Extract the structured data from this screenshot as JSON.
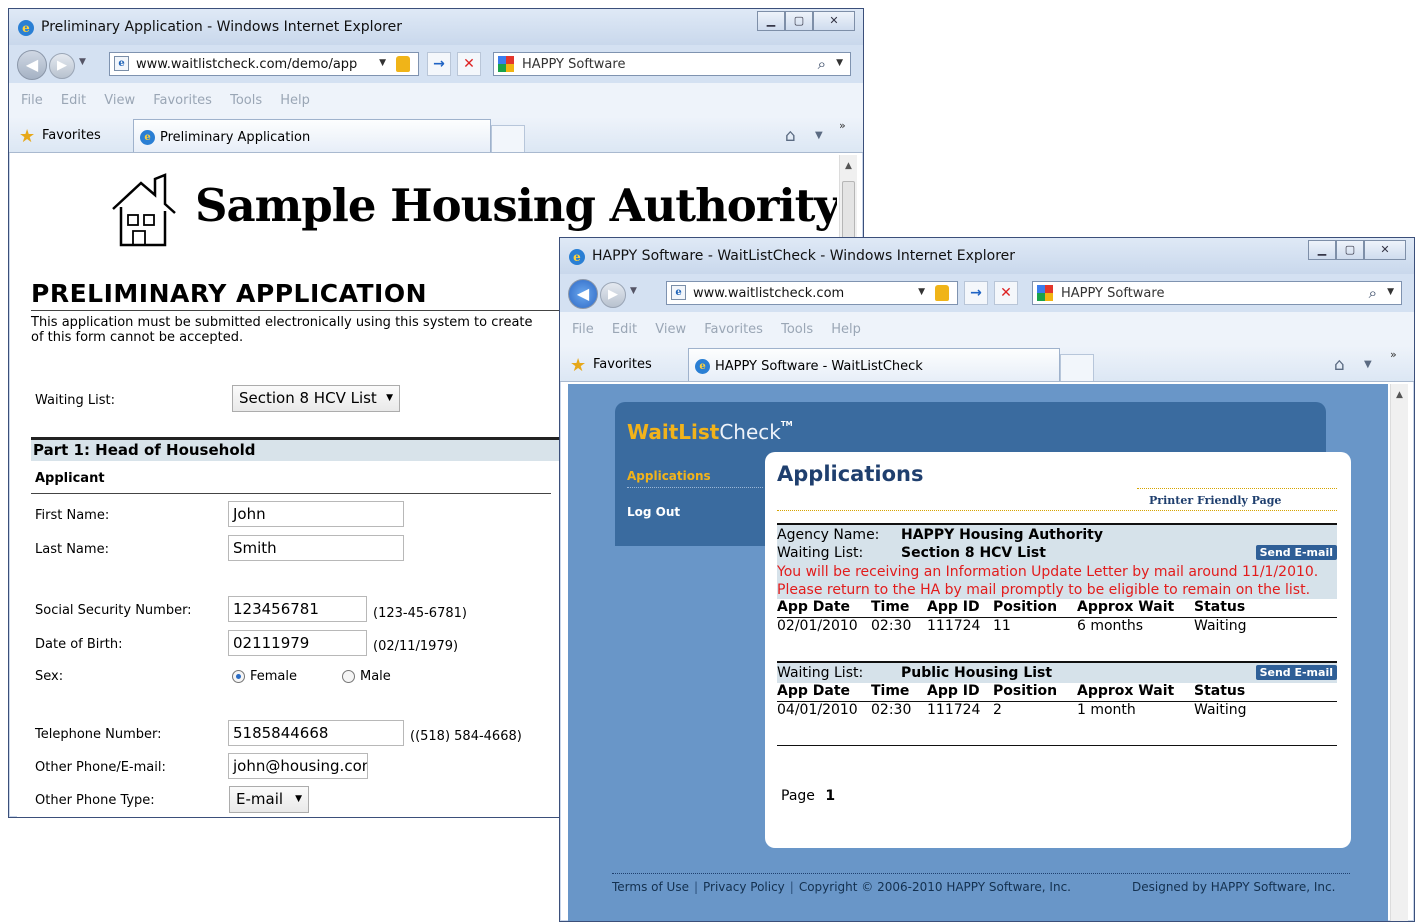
{
  "window1": {
    "title": "Preliminary Application - Windows Internet Explorer",
    "url": "www.waitlistcheck.com/demo/app",
    "search_provider": "HAPPY Software",
    "menu": [
      "File",
      "Edit",
      "View",
      "Favorites",
      "Tools",
      "Help"
    ],
    "favorites_label": "Favorites",
    "tab_title": "Preliminary Application",
    "page": {
      "agency_title": "Sample Housing Authority",
      "heading": "PRELIMINARY APPLICATION",
      "intro": "This application must be submitted electronically using this system to create",
      "intro_line2": "of this form cannot be accepted.",
      "waiting_list_label": "Waiting List:",
      "waiting_list_value": "Section 8 HCV List",
      "part1_heading": "Part 1: Head of Household",
      "applicant_heading": "Applicant",
      "first_name_label": "First Name:",
      "first_name_value": "John",
      "last_name_label": "Last Name:",
      "last_name_value": "Smith",
      "ssn_label": "Social Security Number:",
      "ssn_value": "123456781",
      "ssn_hint": "(123-45-6781)",
      "dob_label": "Date of Birth:",
      "dob_value": "02111979",
      "dob_hint": "(02/11/1979)",
      "sex_label": "Sex:",
      "sex_female": "Female",
      "sex_male": "Male",
      "sex_selected": "Female",
      "phone_label": "Telephone Number:",
      "phone_value": "5185844668",
      "phone_hint": "((518) 584-4668)",
      "other_phone_label": "Other Phone/E-mail:",
      "other_phone_value": "john@housing.com",
      "other_type_label": "Other Phone Type:",
      "other_type_value": "E-mail"
    }
  },
  "window2": {
    "title": "HAPPY Software - WaitListCheck - Windows Internet Explorer",
    "url": "www.waitlistcheck.com",
    "search_provider": "HAPPY Software",
    "menu": [
      "File",
      "Edit",
      "View",
      "Favorites",
      "Tools",
      "Help"
    ],
    "favorites_label": "Favorites",
    "tab_title": "HAPPY Software - WaitListCheck",
    "page": {
      "logo_part1": "WaitList",
      "logo_part2": "Check",
      "logo_tm": "TM",
      "nav_applications": "Applications",
      "nav_logout": "Log Out",
      "heading": "Applications",
      "printer_friendly": "Printer Friendly Page",
      "agency_label": "Agency Name:",
      "agency_value": "HAPPY Housing Authority",
      "lists": [
        {
          "label": "Waiting List:",
          "name": "Section 8 HCV List",
          "send_email": "Send E-mail",
          "alert_line1": "You will be receiving an Information Update Letter by mail around 11/1/2010.",
          "alert_line2": "Please return to the HA by mail promptly to be eligible to remain on the list.",
          "row": {
            "app_date": "02/01/2010",
            "time": "02:30",
            "app_id": "111724",
            "position": "11",
            "approx_wait": "6 months",
            "status": "Waiting"
          }
        },
        {
          "label": "Waiting List:",
          "name": "Public Housing List",
          "send_email": "Send E-mail",
          "row": {
            "app_date": "04/01/2010",
            "time": "02:30",
            "app_id": "111724",
            "position": "2",
            "approx_wait": "1 month",
            "status": "Waiting"
          }
        }
      ],
      "columns": [
        "App Date",
        "Time",
        "App ID",
        "Position",
        "Approx Wait",
        "Status"
      ],
      "page_label": "Page",
      "page_number": "1",
      "footer": {
        "terms": "Terms of Use",
        "privacy": "Privacy Policy",
        "copyright": "Copyright © 2006-2010 HAPPY Software, Inc.",
        "designed": "Designed by HAPPY Software, Inc."
      }
    }
  },
  "icons": {
    "window_buttons": [
      "minimize-icon",
      "maximize-icon",
      "close-icon"
    ],
    "navigation": [
      "back-icon",
      "forward-icon",
      "go-icon",
      "stop-icon",
      "search-icon",
      "home-icon"
    ]
  },
  "colors": {
    "accent_blue": "#3a6b9f",
    "page_background": "#6996c8",
    "logo_gold": "#f2b31a",
    "alert_red": "#e21c1c",
    "send_button": "#2f5f97"
  }
}
